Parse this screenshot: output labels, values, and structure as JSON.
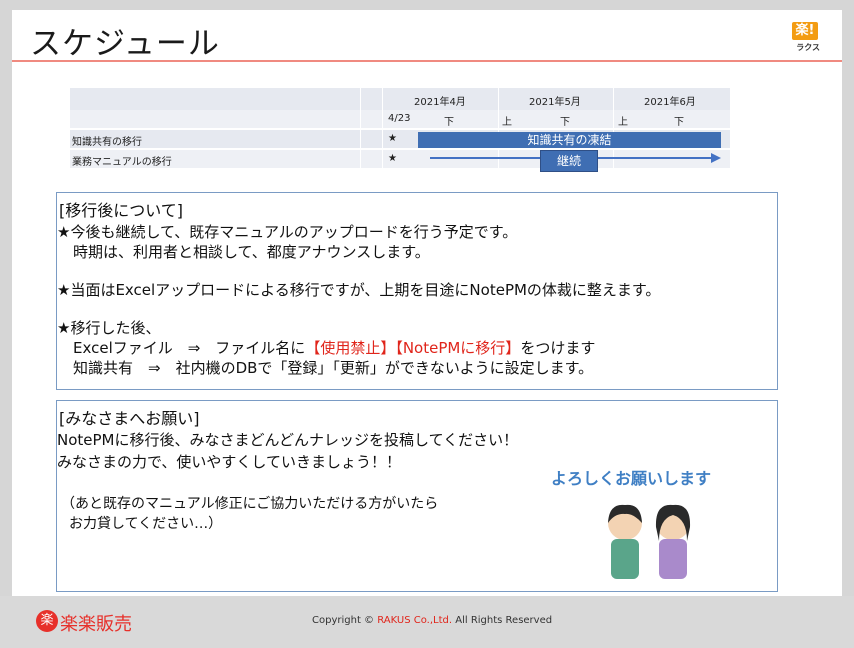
{
  "slide": {
    "title": "スケジュール",
    "logo_mark": "楽!",
    "logo_sub": "ラクス"
  },
  "schedule": {
    "months": [
      "2021年4月",
      "2021年5月",
      "2021年6月"
    ],
    "subheaders": [
      "4/23",
      "下",
      "上",
      "下",
      "上",
      "下"
    ],
    "rows": [
      {
        "label": "知識共有の移行",
        "mark": "★"
      },
      {
        "label": "業務マニュアルの移行",
        "mark": "★"
      }
    ],
    "freeze_bar": "知識共有の凍結",
    "continue_tag": "継続"
  },
  "box1": {
    "heading": "[移行後について]",
    "lines": [
      "★今後も継続して、既存マニュアルのアップロードを行う予定です。",
      "時期は、利用者と相談して、都度アナウンスします。",
      "★当面はExcelアップロードによる移行ですが、上期を目途にNotePMの体裁に整えます。",
      "★移行した後、"
    ],
    "excel_line_prefix": "Excelファイル　⇒　ファイル名に",
    "excel_red": "【使用禁止】【NotePMに移行】",
    "excel_line_suffix": "をつけます",
    "knowledge_line": "知識共有　⇒　社内機のDBで「登録」「更新」ができないように設定します。"
  },
  "box2": {
    "heading": "[みなさまへお願い]",
    "line1": "NotePMに移行後、みなさまどんどんナレッジを投稿してください！",
    "line2": "みなさまの力で、使いやすくしていきましょう！！",
    "line3": "（あと既存のマニュアル修正にご協力いただける方がいたら",
    "line4": "お力貸してください…）",
    "yoroshiku": "よろしくお願いします"
  },
  "footer": {
    "logo_mark": "楽",
    "logo_text": "楽楽販売",
    "copyright_prefix": "Copyright © ",
    "copyright_company": "RAKUS Co.,Ltd.",
    "copyright_suffix": " All Rights Reserved"
  },
  "colors": {
    "accent_blue": "#3f6eb3",
    "accent_red": "#e0251b",
    "title_rule": "#f08a80"
  }
}
